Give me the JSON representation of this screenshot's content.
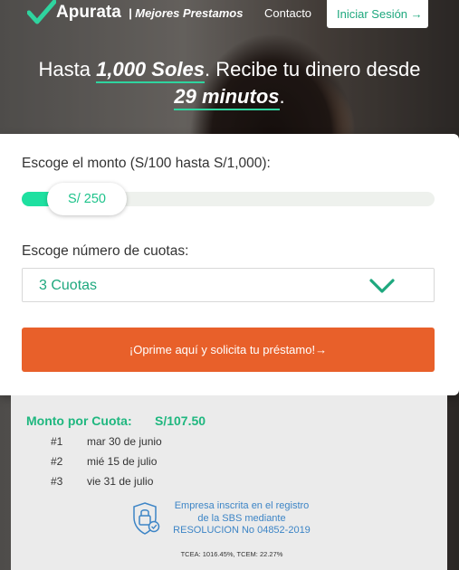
{
  "brand": {
    "name": "Apurata",
    "tagline": "| Mejores Prestamos",
    "accent": "#1ea87e",
    "cta_color": "#e8602a",
    "highlight": "#1ee0a0"
  },
  "nav": {
    "contact": "Contacto",
    "login": "Iniciar Sesión",
    "login_icon": "→"
  },
  "headline": {
    "part1": "Hasta ",
    "amount": "1,000 Soles",
    "part2": ". Recibe tu dinero desde",
    "time": "29 minutos",
    "period": "."
  },
  "form": {
    "amount_label": "Escoge el monto (S/100 hasta S/1,000):",
    "amount_value": "S/ 250",
    "slider_fraction": 0.167,
    "cuotas_label": "Escoge número de cuotas:",
    "cuotas_value": "3 Cuotas",
    "submit": "¡Oprime aquí y solicita tu préstamo!",
    "submit_icon": "→"
  },
  "summary": {
    "monto_label": "Monto por Cuota:",
    "monto_value": "S/107.50",
    "schedule": [
      {
        "num": "#1",
        "date": "mar 30 de junio"
      },
      {
        "num": "#2",
        "date": "mié 15 de julio"
      },
      {
        "num": "#3",
        "date": "vie 31 de julio"
      }
    ],
    "sbs_line1": "Empresa inscrita en el registro",
    "sbs_line2": "de la SBS mediante",
    "sbs_line3": "RESOLUCION No 04852-2019",
    "tcea": "TCEA: 1016.45%, TCEM: 22.27%"
  }
}
